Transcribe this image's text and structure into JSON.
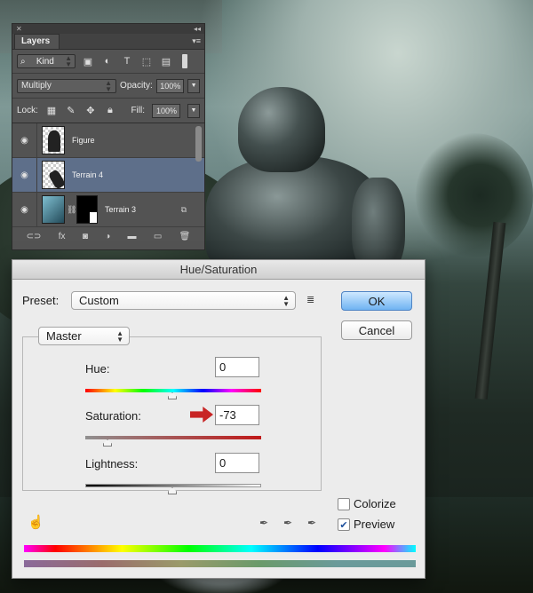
{
  "layers_panel": {
    "tab_label": "Layers",
    "filter_kind": "Kind",
    "blend_mode": "Multiply",
    "opacity_label": "Opacity:",
    "opacity_value": "100%",
    "lock_label": "Lock:",
    "fill_label": "Fill:",
    "fill_value": "100%",
    "layers": [
      {
        "name": "Figure",
        "selected": false
      },
      {
        "name": "Terrain 4",
        "selected": true
      },
      {
        "name": "Terrain 3",
        "selected": false
      }
    ],
    "fx_label": "fx"
  },
  "dialog": {
    "title": "Hue/Saturation",
    "preset_label": "Preset:",
    "preset_value": "Custom",
    "ok_label": "OK",
    "cancel_label": "Cancel",
    "channel_value": "Master",
    "hue_label": "Hue:",
    "hue_value": "0",
    "saturation_label": "Saturation:",
    "saturation_value": "-73",
    "lightness_label": "Lightness:",
    "lightness_value": "0",
    "colorize_label": "Colorize",
    "colorize_checked": false,
    "preview_label": "Preview",
    "preview_checked": true,
    "accent_color": "#6fb3f2",
    "arrow_color": "#c82525"
  }
}
